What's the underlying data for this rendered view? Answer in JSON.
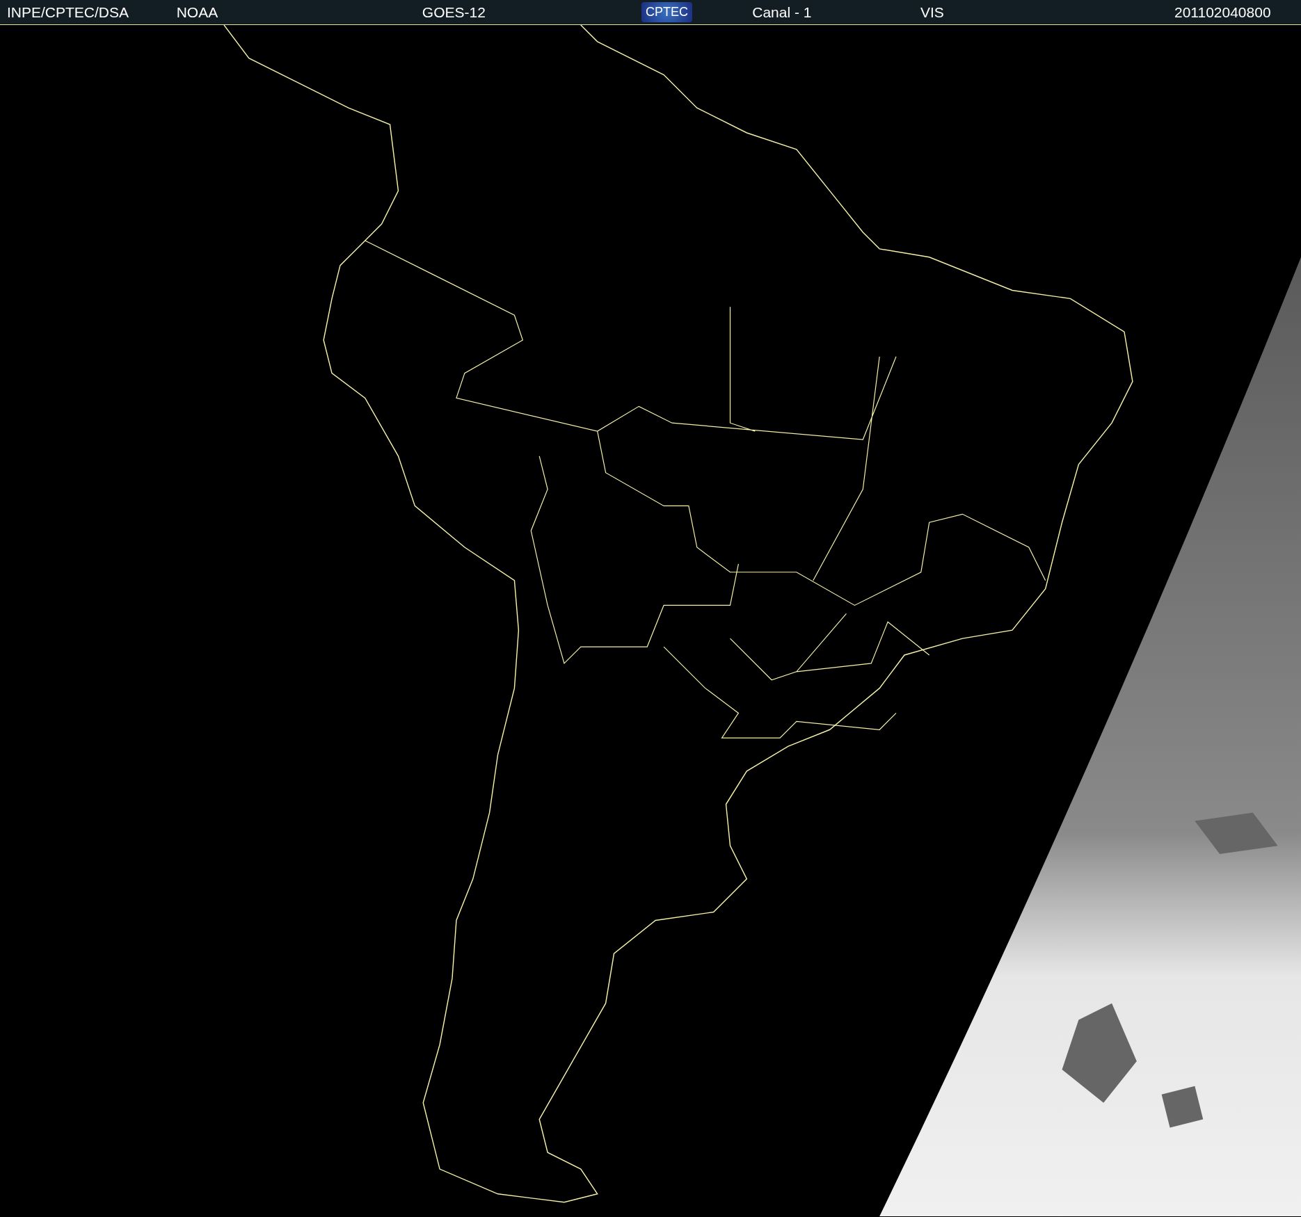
{
  "header": [
    {
      "kind": "text",
      "text": "INPE/CPTEC/DSA"
    },
    {
      "kind": "text",
      "text": "NOAA"
    },
    {
      "kind": "text",
      "text": "GOES-12"
    },
    {
      "kind": "logo",
      "text": "CPTEC"
    },
    {
      "kind": "text",
      "text": "Canal - 1"
    },
    {
      "kind": "text",
      "text": "VIS"
    },
    {
      "kind": "text",
      "text": "201102040800"
    }
  ]
}
